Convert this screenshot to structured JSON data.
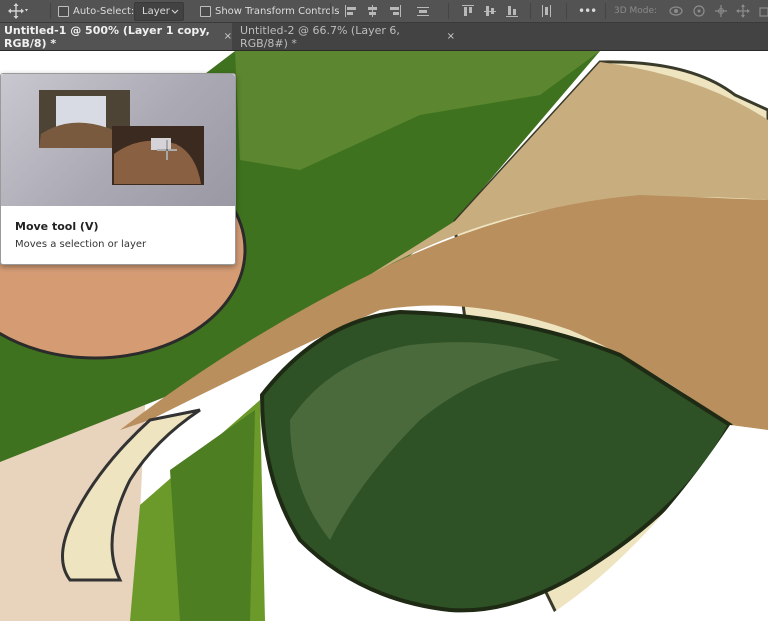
{
  "options_bar": {
    "auto_select_label": "Auto-Select:",
    "auto_select_checked": false,
    "layer_dropdown_value": "Layer",
    "show_transform_label": "Show Transform Controls",
    "show_transform_checked": false,
    "more_label": "•••",
    "mode_3d_label": "3D Mode:"
  },
  "tabs": [
    {
      "label": "Untitled-1 @ 500% (Layer 1 copy, RGB/8) *",
      "close": "×",
      "active": true
    },
    {
      "label": "Untitled-2 @ 66.7% (Layer 6, RGB/8#) *",
      "close": "×",
      "active": false
    }
  ],
  "tooltip": {
    "title": "Move tool (V)",
    "description": "Moves a selection or layer"
  },
  "colors": {
    "options_bar_bg": "#535353",
    "tab_bar_bg": "#434343",
    "green_dark": "#2e5125",
    "green_mid": "#3f721e",
    "tan": "#c0a26f",
    "cream": "#efe4c0",
    "skin": "#d59c74"
  }
}
